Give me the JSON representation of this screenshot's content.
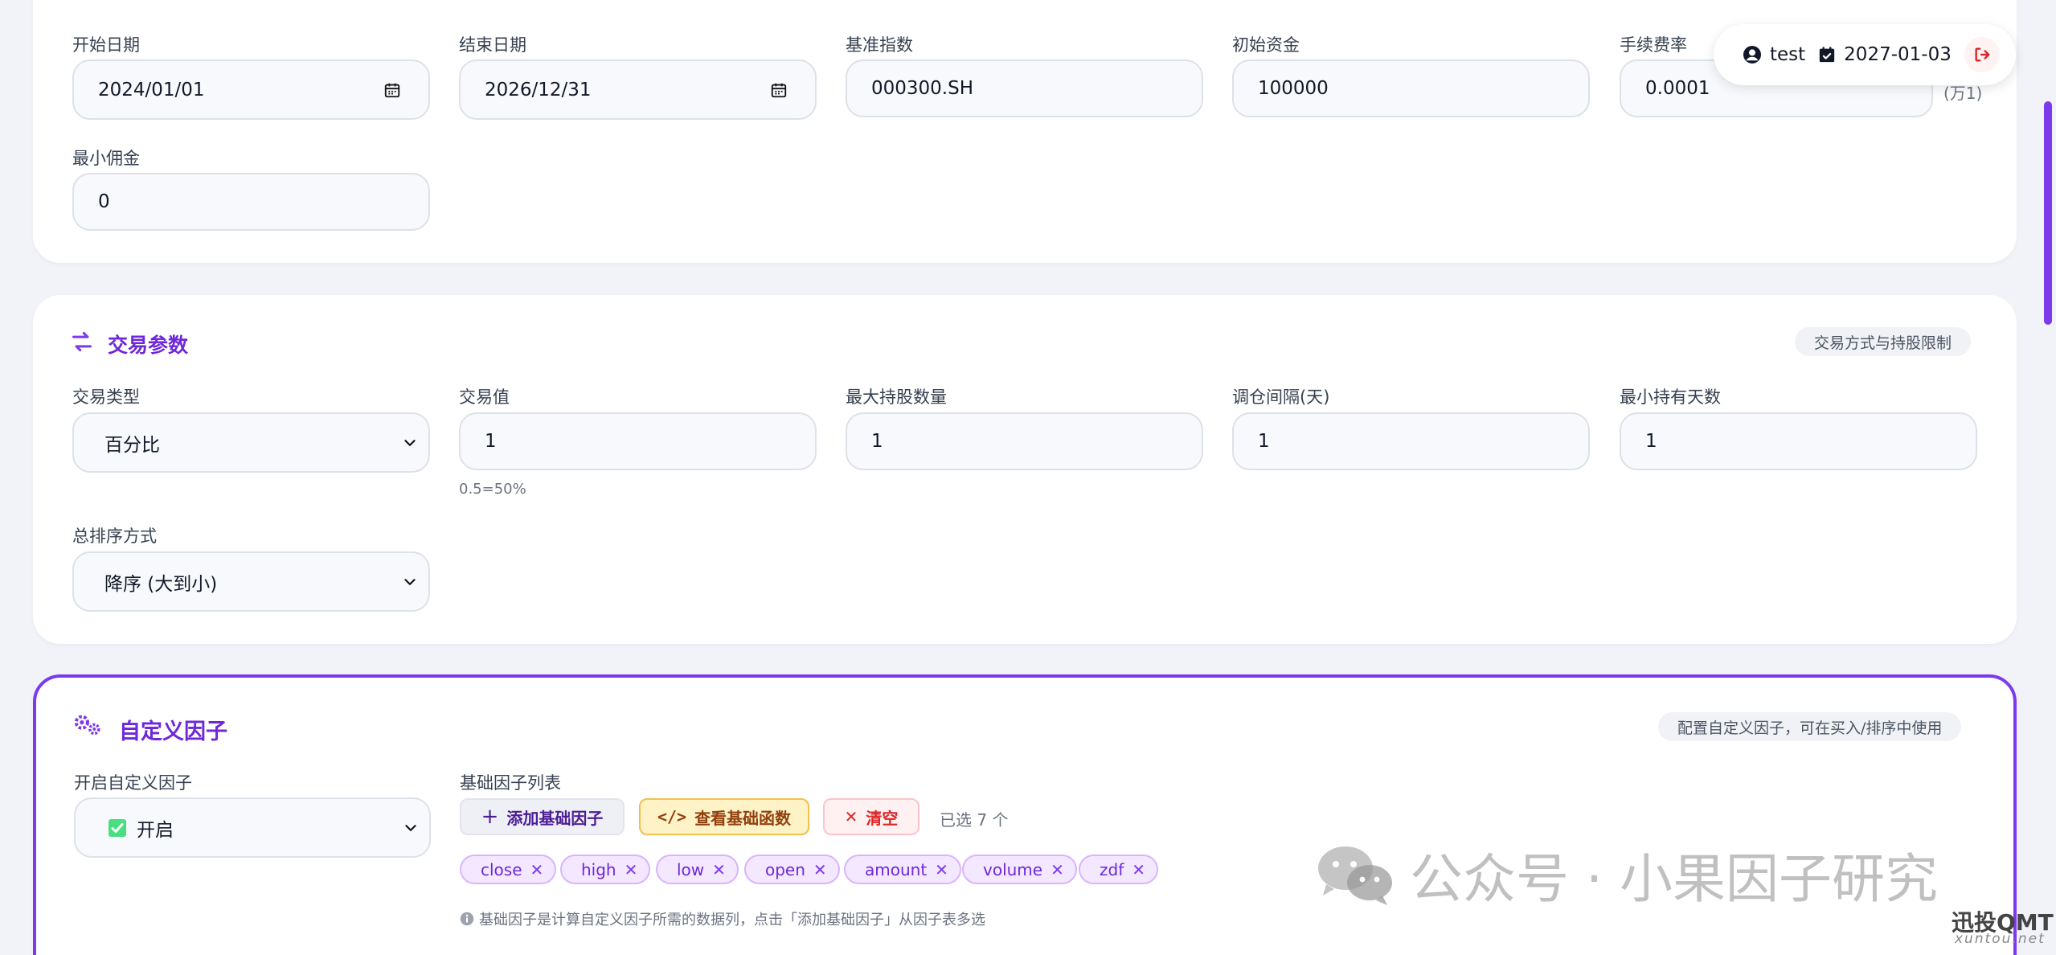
{
  "backtest": {
    "start_date": {
      "label": "开始日期",
      "value": "2024/01/01"
    },
    "end_date": {
      "label": "结束日期",
      "value": "2026/12/31"
    },
    "benchmark": {
      "label": "基准指数",
      "value": "000300.SH"
    },
    "initial_capital": {
      "label": "初始资金",
      "value": "100000"
    },
    "commission": {
      "label": "手续费率",
      "value": "0.0001",
      "suffix": "(万1)"
    },
    "min_commission": {
      "label": "最小佣金",
      "value": "0"
    }
  },
  "trade": {
    "title": "交易参数",
    "note": "交易方式与持股限制",
    "trade_type": {
      "label": "交易类型",
      "value": "百分比"
    },
    "trade_value": {
      "label": "交易值",
      "value": "1",
      "hint": "0.5=50%"
    },
    "max_holdings": {
      "label": "最大持股数量",
      "value": "1"
    },
    "rebalance_interval": {
      "label": "调仓间隔(天)",
      "value": "1"
    },
    "min_hold_days": {
      "label": "最小持有天数",
      "value": "1"
    },
    "sort_order": {
      "label": "总排序方式",
      "value": "降序 (大到小)"
    }
  },
  "custom_factor": {
    "title": "自定义因子",
    "note": "配置自定义因子，可在买入/排序中使用",
    "enable": {
      "label": "开启自定义因子",
      "value": "开启"
    },
    "base_list_label": "基础因子列表",
    "add_button": "添加基础因子",
    "view_button": "查看基础函数",
    "clear_button": "清空",
    "selected_count": "已选 7 个",
    "chips": [
      "close",
      "high",
      "low",
      "open",
      "amount",
      "volume",
      "zdf"
    ],
    "info": "基础因子是计算自定义因子所需的数据列，点击「添加基础因子」从因子表多选"
  },
  "user": {
    "name": "test",
    "date": "2027-01-03"
  },
  "watermark": {
    "text": "公众号 · 小果因子研究",
    "brand": "迅投QMT",
    "domain": "xuntou.net"
  },
  "colors": {
    "accent": "#7c3aed",
    "danger": "#dc2626",
    "warning_bg": "#fef3c7"
  }
}
